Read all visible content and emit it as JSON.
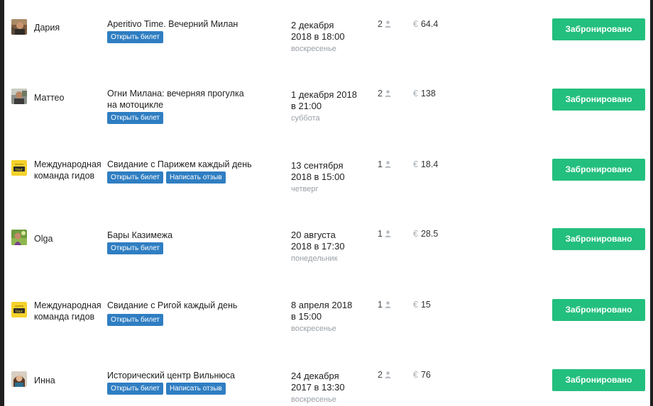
{
  "bookings": [
    {
      "guide": "Дария",
      "guide_line2": "",
      "tour": "Aperitivo Time. Вечерний Милан",
      "buttons": [
        "Открыть билет"
      ],
      "date_line1": "2 декабря",
      "date_line2": "2018 в 18:00",
      "weekday": "воскресенье",
      "count": "2",
      "price": "64.4",
      "status": "Забронировано",
      "avatar": "portrait-photo"
    },
    {
      "guide": "Маттео",
      "guide_line2": "",
      "tour": "Огни Милана: вечерняя прогулка на мотоцикле",
      "buttons": [
        "Открыть билет"
      ],
      "date_line1": "1 декабря 2018",
      "date_line2": "в 21:00",
      "weekday": "суббота",
      "count": "2",
      "price": "138",
      "status": "Забронировано",
      "avatar": "portrait-photo"
    },
    {
      "guide": "Международная",
      "guide_line2": "команда гидов",
      "tour": "Свидание с Парижем каждый день",
      "buttons": [
        "Открыть билет",
        "Написать отзыв"
      ],
      "date_line1": "13 сентября",
      "date_line2": "2018 в 15:00",
      "weekday": "четверг",
      "count": "1",
      "price": "18.4",
      "status": "Забронировано",
      "avatar": "logo"
    },
    {
      "guide": "Olga",
      "guide_line2": "",
      "tour": "Бары Казимежа",
      "buttons": [
        "Открыть билет"
      ],
      "date_line1": "20 августа",
      "date_line2": "2018 в 17:30",
      "weekday": "понедельник",
      "count": "1",
      "price": "28.5",
      "status": "Забронировано",
      "avatar": "portrait-photo"
    },
    {
      "guide": "Международная",
      "guide_line2": "команда гидов",
      "tour": "Свидание с Ригой каждый день",
      "buttons": [
        "Открыть билет"
      ],
      "date_line1": "8 апреля 2018",
      "date_line2": "в 15:00",
      "weekday": "воскресенье",
      "count": "1",
      "price": "15",
      "status": "Забронировано",
      "avatar": "logo"
    },
    {
      "guide": "Инна",
      "guide_line2": "",
      "tour": "Исторический центр Вильнюса",
      "buttons": [
        "Открыть билет",
        "Написать отзыв"
      ],
      "date_line1": "24 декабря",
      "date_line2": "2017 в 13:30",
      "weekday": "воскресенье",
      "count": "2",
      "price": "76",
      "status": "Забронировано",
      "avatar": "portrait-photo"
    }
  ],
  "currency_symbol": "€",
  "colors": {
    "accent_button": "#23bf7e",
    "ticket_button": "#2f7ec2",
    "muted_text": "#9aa0a6",
    "logo_yellow": "#f5d22b"
  }
}
